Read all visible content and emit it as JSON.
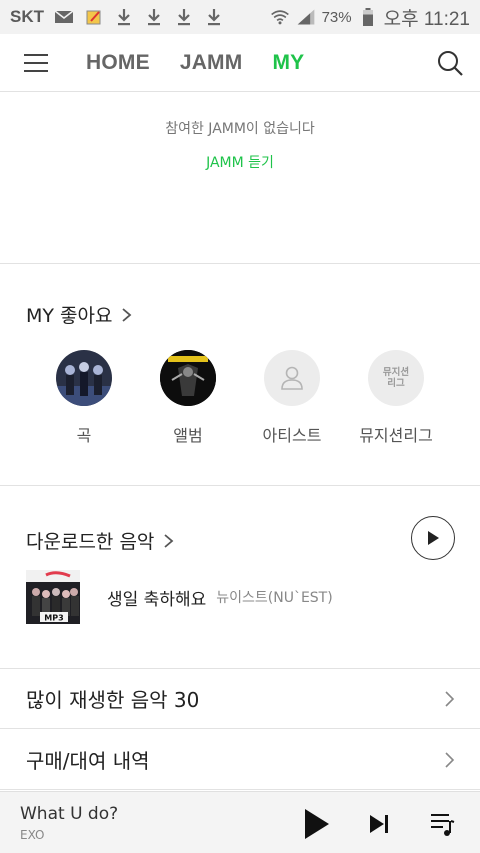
{
  "status_bar": {
    "carrier": "SKT",
    "battery_percent": "73%",
    "time": "오후 11:21",
    "icons": [
      "mail-icon",
      "note-icon",
      "download-icon",
      "download-icon",
      "download-icon",
      "download-icon",
      "wifi-icon",
      "signal-icon",
      "battery-icon"
    ]
  },
  "nav": {
    "tabs": [
      {
        "label": "HOME",
        "active": false
      },
      {
        "label": "JAMM",
        "active": false
      },
      {
        "label": "MY",
        "active": true
      }
    ]
  },
  "jamm": {
    "empty_message": "참여한 JAMM이 없습니다",
    "listen_link": "JAMM 듣기"
  },
  "likes": {
    "title": "MY 좋아요",
    "items": [
      {
        "label": "곡"
      },
      {
        "label": "앨범"
      },
      {
        "label": "아티스트"
      },
      {
        "label": "뮤지션리그",
        "placeholder_text": "뮤지션\n리그"
      }
    ]
  },
  "downloads": {
    "title": "다운로드한 음악",
    "track": {
      "title": "생일 축하해요",
      "artist": "뉴이스트(NU`EST)",
      "thumb_text": "MP3"
    }
  },
  "lists": [
    {
      "label": "많이 재생한 음악 30"
    },
    {
      "label": "구매/대여 내역"
    }
  ],
  "player": {
    "title": "What U do?",
    "artist": "EXO"
  },
  "colors": {
    "accent": "#1fc34a",
    "divider": "#e2e2e2"
  }
}
